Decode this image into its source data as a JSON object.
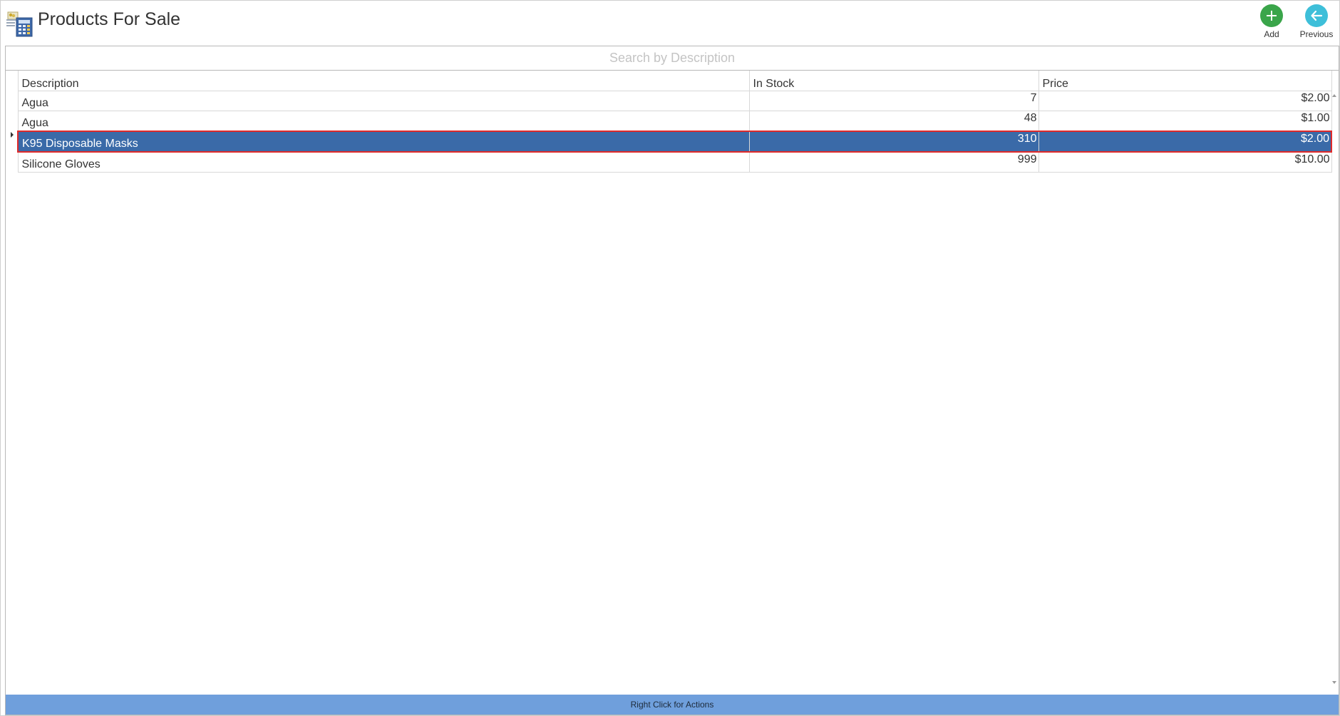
{
  "header": {
    "title": "Products For Sale",
    "add_label": "Add",
    "previous_label": "Previous"
  },
  "search": {
    "placeholder": "Search by Description",
    "value": ""
  },
  "table": {
    "columns": [
      "Description",
      "In Stock",
      "Price"
    ],
    "rows": [
      {
        "description": "Agua",
        "in_stock": "7",
        "price": "$2.00"
      },
      {
        "description": "Agua",
        "in_stock": "48",
        "price": "$1.00"
      },
      {
        "description": "K95 Disposable Masks",
        "in_stock": "310",
        "price": "$2.00",
        "selected": true
      },
      {
        "description": "Silicone Gloves",
        "in_stock": "999",
        "price": "$10.00"
      }
    ]
  },
  "status_bar": {
    "text": "Right Click for Actions"
  },
  "colors": {
    "selected_row": "#3a6aa8",
    "selected_outline": "#e02a2a",
    "status_bar": "#6f9fdc",
    "add_button": "#3aa54a",
    "previous_button": "#3ebfd9"
  }
}
